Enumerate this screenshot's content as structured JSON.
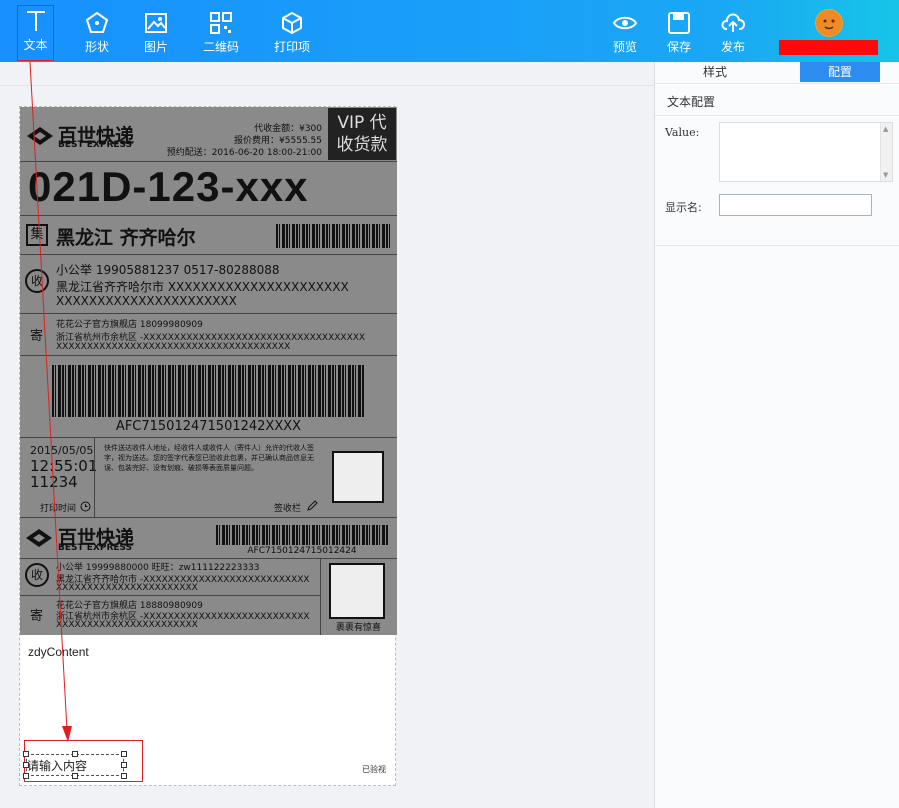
{
  "toolbar": {
    "left_tools": [
      {
        "label": "文本",
        "icon": "text-icon"
      },
      {
        "label": "形状",
        "icon": "shape-icon"
      },
      {
        "label": "图片",
        "icon": "image-icon"
      },
      {
        "label": "二维码",
        "icon": "qrcode-icon"
      },
      {
        "label": "打印项",
        "icon": "print-item-icon"
      }
    ],
    "right_tools": [
      {
        "label": "预览",
        "icon": "eye-icon"
      },
      {
        "label": "保存",
        "icon": "save-icon"
      },
      {
        "label": "发布",
        "icon": "cloud-upload-icon"
      }
    ],
    "active_tool": "文本"
  },
  "panel": {
    "tabs": [
      "样式",
      "配置"
    ],
    "active_tab": "配置",
    "section_title": "文本配置",
    "value_label": "Value:",
    "value_text": "",
    "display_name_label": "显示名:",
    "display_name_value": ""
  },
  "label": {
    "brand_cn": "百世快递",
    "brand_en": "BEST EXPRESS",
    "cod_amount": "代收金额：¥300",
    "fee": "报价费用：¥5555.55",
    "delivery": "预约配送：2016-06-20 18:00-21:00",
    "vip_line1": "VIP 代",
    "vip_line2": "收货款",
    "big_code": "021D-123-xxx",
    "ji": "集",
    "region": "黑龙江 齐齐哈尔",
    "shou": "收",
    "receiver_line": "小公举    19905881237    0517-80288088",
    "receiver_addr1": "黑龙江省齐齐哈尔市 XXXXXXXXXXXXXXXXXXXXXX",
    "receiver_addr2": "XXXXXXXXXXXXXXXXXXXXXX",
    "ji2": "寄",
    "sender_line": "花花公子官方旗舰店    18099980909",
    "sender_addr1": "浙江省杭州市余杭区 -XXXXXXXXXXXXXXXXXXXXXXXXXXXXXXXXXXXX",
    "sender_addr2": "XXXXXXXXXXXXXXXXXXXXXXXXXXXXXXXXXXXXXX",
    "tracking_no": "AFC715012471501242XXXX",
    "date": "2015/05/05",
    "time": "12:55:01",
    "count": "11234",
    "notice": "快件送达收件人地址，经收件人或收件人（寄件人）允许的代收人签字，视为送达。您的签字代表您已验收此包裹，并已确认商品信息无误、包装完好、没有划痕、破损等表面质量问题。",
    "print_time": "打印时间",
    "sign": "签收栏",
    "tracking_no2": "AFC7150124715012424",
    "receiver_line2": "小公举    19999880000    旺旺：zw111122223333",
    "receiver_addr_b": "黑龙江省齐齐哈尔市 -XXXXXXXXXXXXXXXXXXXXXXXXXXX",
    "receiver_addr_b2": "XXXXXXXXXXXXXXXXXXXXXXX",
    "sender_line2": "花花公子官方旗舰店    18880980909",
    "sender_addr_b": "浙江省杭州市余杭区 -XXXXXXXXXXXXXXXXXXXXXXXXXXX",
    "sender_addr_b2": "XXXXXXXXXXXXXXXXXXXXXXX",
    "qr_caption": "裹裹有惊喜"
  },
  "canvas": {
    "custom_content": "zdyContent",
    "placeholder_text": "请输入内容",
    "inspected": "已验视"
  }
}
